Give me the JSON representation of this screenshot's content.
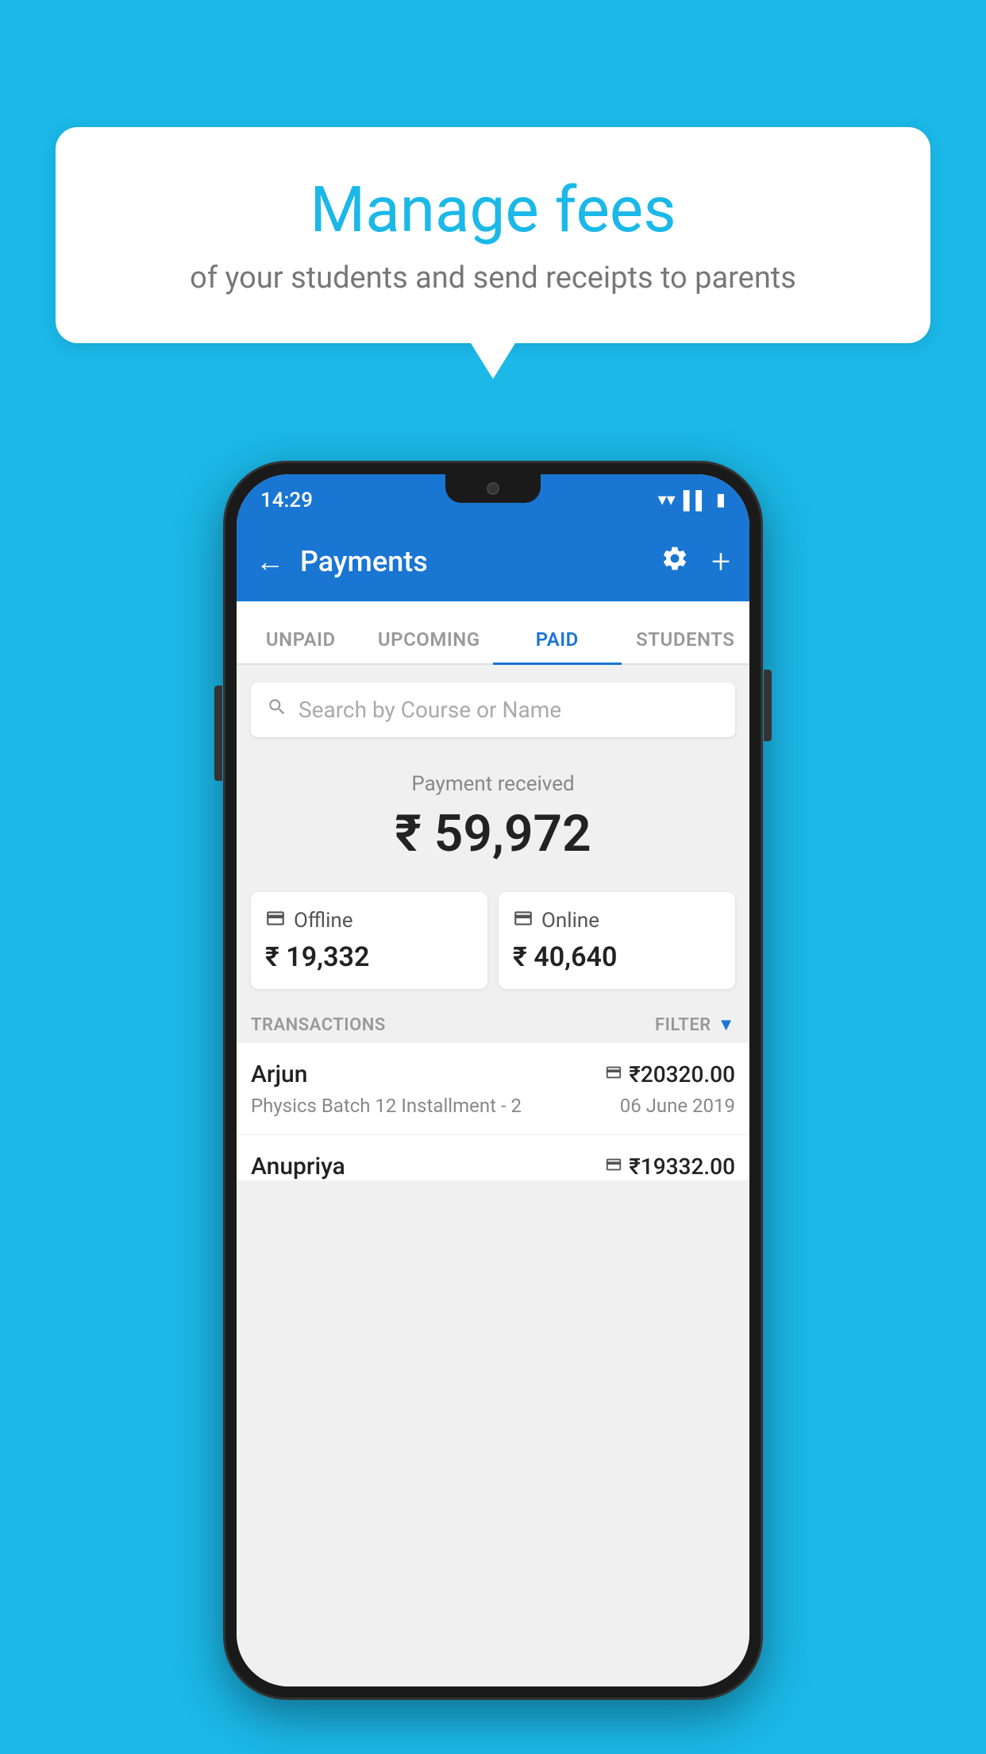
{
  "background_color": "#1BB8E8",
  "speech_bubble": {
    "title": "Manage fees",
    "subtitle": "of your students and send receipts to parents"
  },
  "phone": {
    "status_bar": {
      "time": "14:29"
    },
    "app_bar": {
      "title": "Payments",
      "back_icon": "←",
      "gear_icon": "⚙",
      "plus_icon": "+"
    },
    "tabs": [
      {
        "label": "UNPAID",
        "active": false
      },
      {
        "label": "UPCOMING",
        "active": false
      },
      {
        "label": "PAID",
        "active": true
      },
      {
        "label": "STUDENTS",
        "active": false
      }
    ],
    "search": {
      "placeholder": "Search by Course or Name"
    },
    "payment_received": {
      "label": "Payment received",
      "amount": "₹ 59,972"
    },
    "payment_cards": [
      {
        "type": "Offline",
        "amount": "₹ 19,332",
        "icon": "💳"
      },
      {
        "type": "Online",
        "amount": "₹ 40,640",
        "icon": "💳"
      }
    ],
    "transactions_section": {
      "header_label": "TRANSACTIONS",
      "filter_label": "FILTER"
    },
    "transactions": [
      {
        "name": "Arjun",
        "course": "Physics Batch 12 Installment - 2",
        "amount": "₹20320.00",
        "date": "06 June 2019",
        "payment_type": "online"
      },
      {
        "name": "Anupriya",
        "course": "",
        "amount": "₹19332.00",
        "date": "",
        "payment_type": "offline"
      }
    ]
  }
}
